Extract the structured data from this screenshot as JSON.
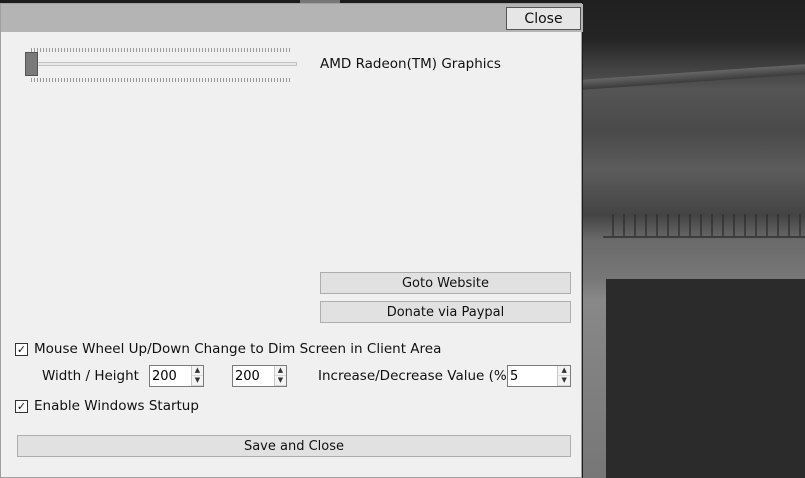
{
  "window": {
    "close_label": "Close"
  },
  "slider": {
    "value_fraction": 0.0
  },
  "gpu_label": "AMD Radeon(TM) Graphics",
  "buttons": {
    "goto_website": "Goto Website",
    "donate": "Donate via Paypal",
    "save_close": "Save and Close"
  },
  "options": {
    "mouse_wheel_label": "Mouse Wheel Up/Down Change to Dim Screen in Client Area",
    "mouse_wheel_checked": true,
    "width_height_label": "Width / Height",
    "width_value": "200",
    "height_value": "200",
    "increase_label": "Increase/Decrease Value (%)",
    "increase_value": "5",
    "startup_label": "Enable Windows Startup",
    "startup_checked": true
  },
  "check_glyph": "✓"
}
